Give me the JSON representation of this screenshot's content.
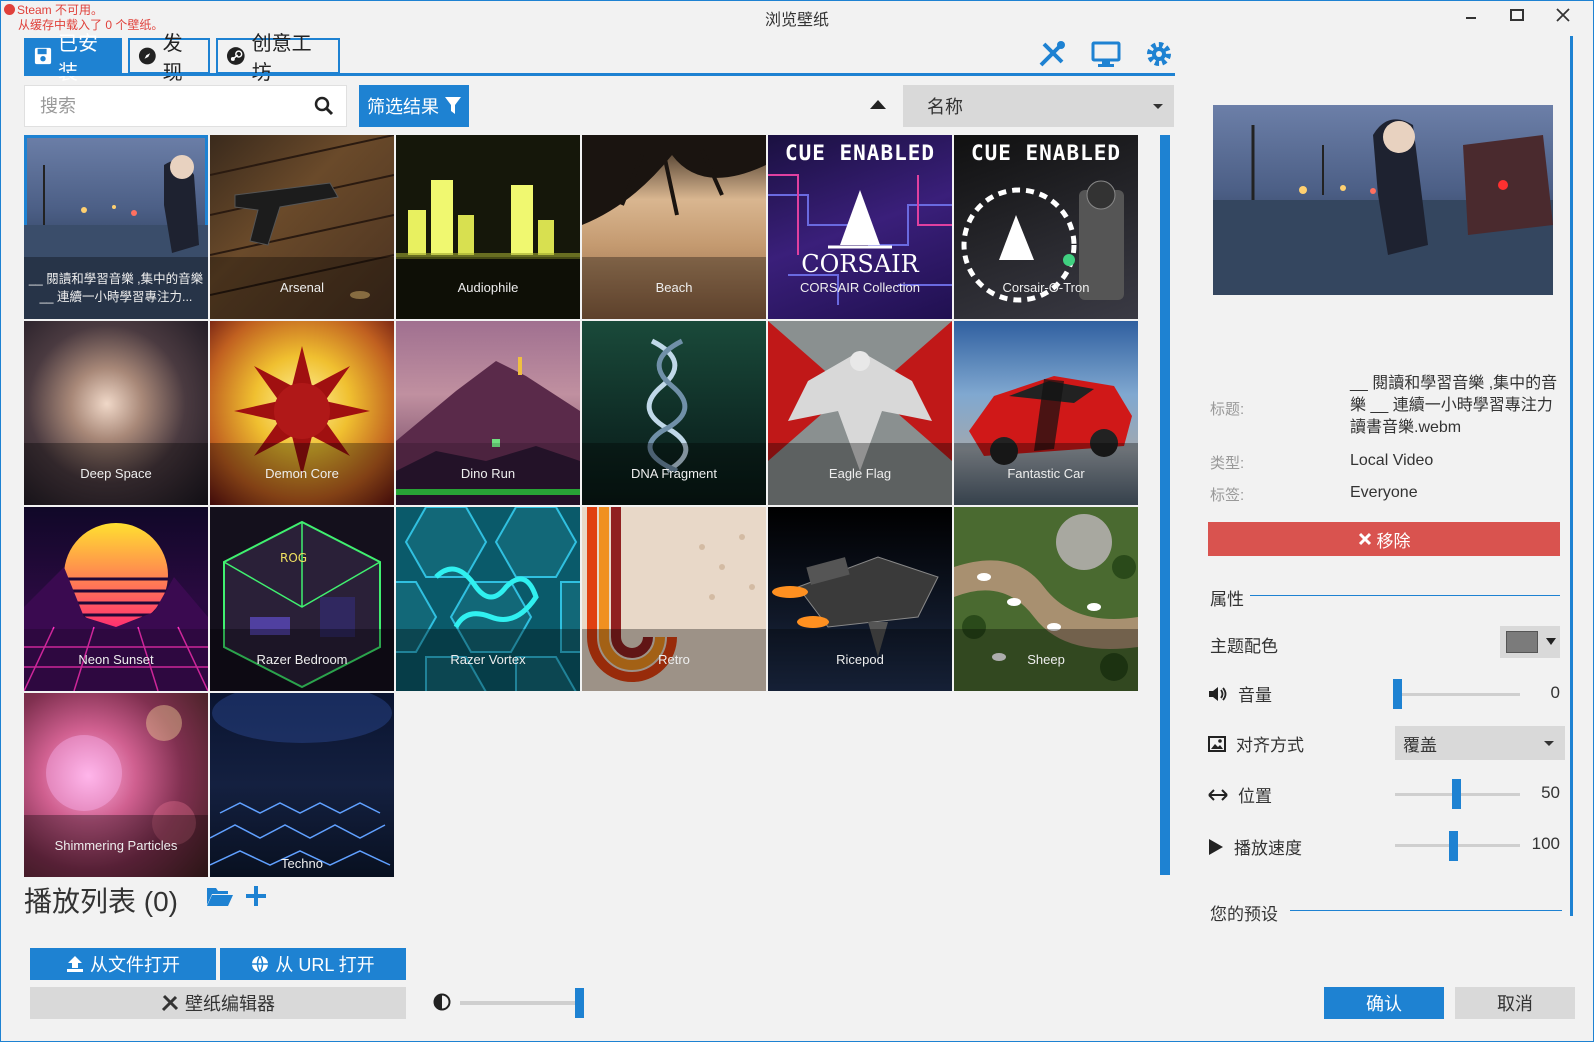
{
  "window": {
    "title": "浏览壁纸",
    "steam_warning_line1": "Steam 不可用。",
    "steam_warning_line2": "从缓存中载入了 0 个壁纸。"
  },
  "tabs": [
    {
      "label": "已安装",
      "icon": "save-icon",
      "active": true
    },
    {
      "label": "发现",
      "icon": "compass-icon",
      "active": false
    },
    {
      "label": "创意工坊",
      "icon": "steam-icon",
      "active": false
    }
  ],
  "toolbar_icons": [
    "editor-tools-icon",
    "monitor-icon",
    "gear-icon"
  ],
  "search": {
    "placeholder": "搜索",
    "value": ""
  },
  "filter_button": {
    "label": "筛选结果"
  },
  "sort": {
    "selected": "名称",
    "direction": "ascending"
  },
  "wallpapers": [
    {
      "title": "__ 閱讀和學習音樂 ,集中的音樂 __ 連續一小時學習專注力...",
      "selected": true
    },
    {
      "title": "Arsenal"
    },
    {
      "title": "Audiophile"
    },
    {
      "title": "Beach"
    },
    {
      "title": "CORSAIR Collection",
      "badge": "CUE ENABLED",
      "badge2": "CORSAIR"
    },
    {
      "title": "Corsair-O-Tron",
      "badge": "CUE ENABLED"
    },
    {
      "title": "Deep Space"
    },
    {
      "title": "Demon Core"
    },
    {
      "title": "Dino Run"
    },
    {
      "title": "DNA Fragment"
    },
    {
      "title": "Eagle Flag"
    },
    {
      "title": "Fantastic Car"
    },
    {
      "title": "Neon Sunset"
    },
    {
      "title": "Razer Bedroom"
    },
    {
      "title": "Razer Vortex"
    },
    {
      "title": "Retro"
    },
    {
      "title": "Ricepod"
    },
    {
      "title": "Sheep"
    },
    {
      "title": "Shimmering Particles"
    },
    {
      "title": "Techno"
    }
  ],
  "playlist": {
    "label": "播放列表 (0)"
  },
  "buttons": {
    "open_file": "从文件打开",
    "open_url": "从 URL 打开",
    "editor": "壁纸编辑器",
    "confirm": "确认",
    "cancel": "取消",
    "remove": "移除"
  },
  "brightness": {
    "value": 1.0
  },
  "details": {
    "title_key": "标题:",
    "title_value": "__ 閱讀和學習音樂 ,集中的音樂 __ 連續一小時學習專注力讀書音樂.webm",
    "type_key": "类型:",
    "type_value": "Local Video",
    "tags_key": "标签:",
    "tags_value": "Everyone"
  },
  "properties": {
    "section_label": "属性",
    "theme_color_label": "主题配色",
    "theme_color": "#7b7b7b",
    "volume_label": "音量",
    "volume_value": "0",
    "alignment_label": "对齐方式",
    "alignment_value": "覆盖",
    "position_label": "位置",
    "position_value": "50",
    "speed_label": "播放速度",
    "speed_value": "100",
    "presets_label": "您的预设"
  },
  "colors": {
    "accent": "#1e82d2",
    "danger": "#d9534f",
    "warning": "#e0413b"
  }
}
